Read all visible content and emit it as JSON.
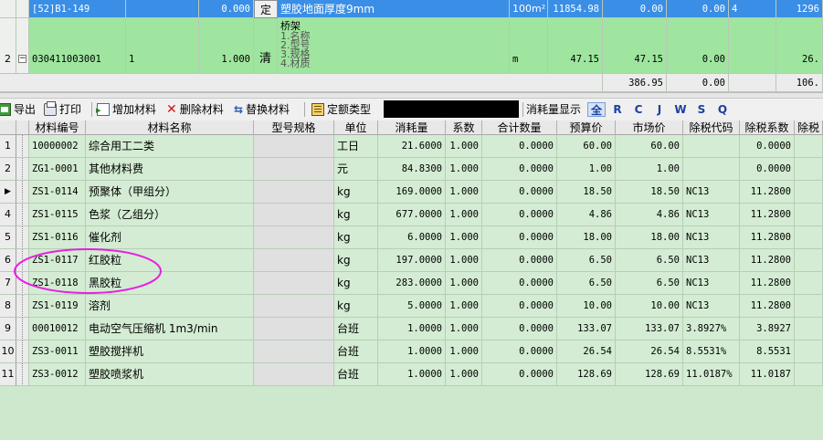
{
  "top_grid": {
    "row_selected": {
      "code": "[52]B1-149",
      "quantity": "0.000",
      "type": "定",
      "name": "塑胶地面厚度9mm",
      "unit": "100m²",
      "price1": "11854.98",
      "price2": "0.00",
      "price3": "0.00",
      "extra": "4",
      "last": "1296"
    },
    "row_2": {
      "num": "2",
      "code": "030411003001",
      "q1": "1",
      "q2": "1.000",
      "type": "清",
      "name_lines": [
        "桥架",
        "1.名称",
        "2.型号",
        "3.规格",
        "4.材质"
      ],
      "unit": "m",
      "price1": "47.15",
      "price2": "47.15",
      "price3": "0.00",
      "last": "26."
    },
    "totals": {
      "t1": "386.95",
      "t2": "0.00",
      "t3": "106."
    }
  },
  "toolbar": {
    "export_label": "导出",
    "print_label": "打印",
    "add_label": "增加材料",
    "delete_label": "删除材料",
    "replace_label": "替换材料",
    "quota_type_label": "定额类型",
    "consumption_label": "消耗量显示",
    "filters": [
      "全",
      "R",
      "C",
      "J",
      "W",
      "S",
      "Q"
    ],
    "active_filter": "全"
  },
  "table": {
    "columns": [
      "材料编号",
      "材料名称",
      "型号规格",
      "单位",
      "消耗量",
      "系数",
      "合计数量",
      "预算价",
      "市场价",
      "除税代码",
      "除税系数",
      "除税"
    ],
    "rows": [
      {
        "num": "1",
        "code": "10000002",
        "name": "综合用工二类",
        "spec": "",
        "unit": "工日",
        "consumption": "21.6000",
        "coef": "1.000",
        "total": "0.0000",
        "budget": "60.00",
        "market": "60.00",
        "tax_code": "",
        "tax_coef": "0.0000"
      },
      {
        "num": "2",
        "code": "ZG1-0001",
        "name": "其他材料费",
        "spec": "",
        "unit": "元",
        "consumption": "84.8300",
        "coef": "1.000",
        "total": "0.0000",
        "budget": "1.00",
        "market": "1.00",
        "tax_code": "",
        "tax_coef": "0.0000"
      },
      {
        "num": "▶",
        "code": "ZS1-0114",
        "name": "预聚体（甲组分）",
        "spec": "",
        "unit": "kg",
        "consumption": "169.0000",
        "coef": "1.000",
        "total": "0.0000",
        "budget": "18.50",
        "market": "18.50",
        "tax_code": "NC13",
        "tax_coef": "11.2800"
      },
      {
        "num": "4",
        "code": "ZS1-0115",
        "name": "色浆（乙组分）",
        "spec": "",
        "unit": "kg",
        "consumption": "677.0000",
        "coef": "1.000",
        "total": "0.0000",
        "budget": "4.86",
        "market": "4.86",
        "tax_code": "NC13",
        "tax_coef": "11.2800"
      },
      {
        "num": "5",
        "code": "ZS1-0116",
        "name": "催化剂",
        "spec": "",
        "unit": "kg",
        "consumption": "6.0000",
        "coef": "1.000",
        "total": "0.0000",
        "budget": "18.00",
        "market": "18.00",
        "tax_code": "NC13",
        "tax_coef": "11.2800"
      },
      {
        "num": "6",
        "code": "ZS1-0117",
        "name": "红胶粒",
        "spec": "",
        "unit": "kg",
        "consumption": "197.0000",
        "coef": "1.000",
        "total": "0.0000",
        "budget": "6.50",
        "market": "6.50",
        "tax_code": "NC13",
        "tax_coef": "11.2800"
      },
      {
        "num": "7",
        "code": "ZS1-0118",
        "name": "黑胶粒",
        "spec": "",
        "unit": "kg",
        "consumption": "283.0000",
        "coef": "1.000",
        "total": "0.0000",
        "budget": "6.50",
        "market": "6.50",
        "tax_code": "NC13",
        "tax_coef": "11.2800"
      },
      {
        "num": "8",
        "code": "ZS1-0119",
        "name": "溶剂",
        "spec": "",
        "unit": "kg",
        "consumption": "5.0000",
        "coef": "1.000",
        "total": "0.0000",
        "budget": "10.00",
        "market": "10.00",
        "tax_code": "NC13",
        "tax_coef": "11.2800"
      },
      {
        "num": "9",
        "code": "00010012",
        "name": "电动空气压缩机 1m3/min",
        "spec": "",
        "unit": "台班",
        "consumption": "1.0000",
        "coef": "1.000",
        "total": "0.0000",
        "budget": "133.07",
        "market": "133.07",
        "tax_code": "3.8927%",
        "tax_coef": "3.8927"
      },
      {
        "num": "10",
        "code": "ZS3-0011",
        "name": "塑胶搅拌机",
        "spec": "",
        "unit": "台班",
        "consumption": "1.0000",
        "coef": "1.000",
        "total": "0.0000",
        "budget": "26.54",
        "market": "26.54",
        "tax_code": "8.5531%",
        "tax_coef": "8.5531"
      },
      {
        "num": "11",
        "code": "ZS3-0012",
        "name": "塑胶喷浆机",
        "spec": "",
        "unit": "台班",
        "consumption": "1.0000",
        "coef": "1.000",
        "total": "0.0000",
        "budget": "128.69",
        "market": "128.69",
        "tax_code": "11.0187%",
        "tax_coef": "11.0187"
      }
    ]
  },
  "colors": {
    "selected": "#3a8ee6",
    "row_green": "#9fe59f",
    "grid_green": "#d3ecd3",
    "highlight_circle": "#e81ee0"
  }
}
